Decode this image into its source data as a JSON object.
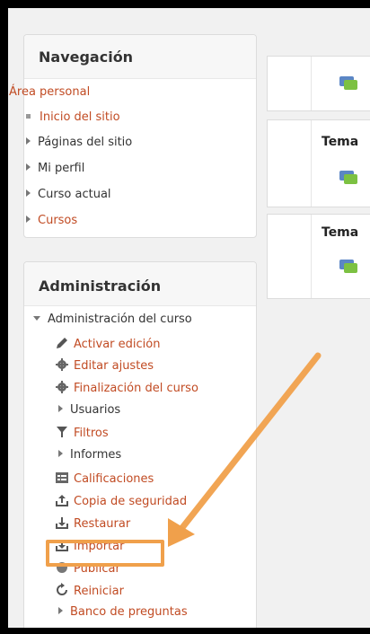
{
  "navigation": {
    "title": "Navegación",
    "items": [
      {
        "label": "Área personal",
        "style": "link",
        "marker": "none"
      },
      {
        "label": "Inicio del sitio",
        "style": "link",
        "marker": "square"
      },
      {
        "label": "Páginas del sitio",
        "style": "text",
        "marker": "triangle"
      },
      {
        "label": "Mi perfil",
        "style": "text",
        "marker": "triangle"
      },
      {
        "label": "Curso actual",
        "style": "text",
        "marker": "triangle"
      },
      {
        "label": "Cursos",
        "style": "link",
        "marker": "triangle"
      }
    ]
  },
  "administration": {
    "title": "Administración",
    "course_admin_label": "Administración del curso",
    "items": [
      {
        "label": "Activar edición",
        "icon": "pencil-icon"
      },
      {
        "label": "Editar ajustes",
        "icon": "gear-icon"
      },
      {
        "label": "Finalización del curso",
        "icon": "gear-icon"
      },
      {
        "label": "Usuarios",
        "icon": "triangle-icon"
      },
      {
        "label": "Filtros",
        "icon": "filter-icon"
      },
      {
        "label": "Informes",
        "icon": "triangle-icon"
      },
      {
        "label": "Calificaciones",
        "icon": "grades-icon"
      },
      {
        "label": "Copia de seguridad",
        "icon": "backup-icon"
      },
      {
        "label": "Restaurar",
        "icon": "restore-icon"
      },
      {
        "label": "Importar",
        "icon": "import-icon"
      },
      {
        "label": "Publicar",
        "icon": "publish-icon"
      },
      {
        "label": "Reiniciar",
        "icon": "reset-icon"
      },
      {
        "label": "Banco de preguntas",
        "icon": "triangle-icon"
      }
    ]
  },
  "course_sections": [
    {
      "title": ""
    },
    {
      "title": "Tema"
    },
    {
      "title": "Tema"
    }
  ],
  "colors": {
    "link": "#c14b23",
    "highlight": "#f0a04b",
    "background": "#f1f1f1"
  }
}
